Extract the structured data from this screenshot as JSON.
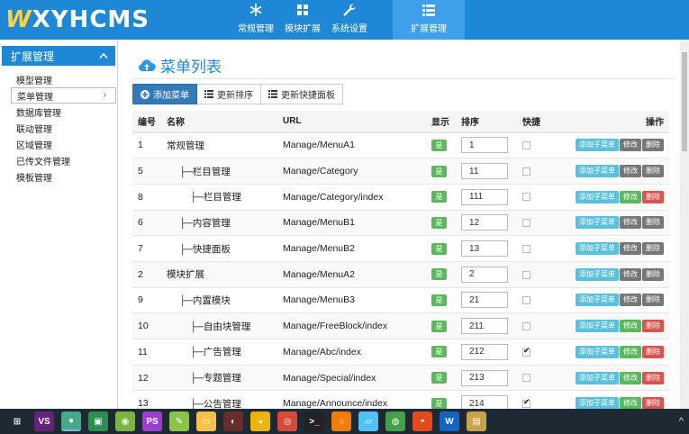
{
  "logo": {
    "mark": "W",
    "text": "XYHCMS"
  },
  "nav": [
    {
      "label": "常规管理",
      "icon": "snowflake-icon"
    },
    {
      "label": "模块扩展",
      "icon": "grid-icon"
    },
    {
      "label": "系统设置",
      "icon": "wrench-icon"
    },
    {
      "label": "扩展管理",
      "icon": "list-icon",
      "active": true
    }
  ],
  "sidebar": {
    "title": "扩展管理",
    "items": [
      {
        "label": "模型管理"
      },
      {
        "label": "菜单管理",
        "active": true,
        "arrow": "›"
      },
      {
        "label": "数据库管理"
      },
      {
        "label": "联动管理"
      },
      {
        "label": "区域管理"
      },
      {
        "label": "已传文件管理"
      },
      {
        "label": "模板管理"
      }
    ]
  },
  "main": {
    "title": "菜单列表",
    "toolbar": {
      "add": "添加菜单",
      "sort": "更新排序",
      "quick": "更新快捷面板"
    },
    "columns": {
      "id": "编号",
      "name": "名称",
      "url": "URL",
      "show": "显示",
      "sort": "排序",
      "quick": "快捷",
      "ops": "操作"
    },
    "show_label": "是",
    "ops": {
      "add": "添加子菜单",
      "edit": "修改",
      "del": "删除"
    },
    "rows": [
      {
        "id": "1",
        "name": "常规管理",
        "url": "Manage/MenuA1",
        "sort": "1",
        "quick": false,
        "deletable": false
      },
      {
        "id": "5",
        "name": "├─栏目管理",
        "url": "Manage/Category",
        "sort": "11",
        "quick": false,
        "deletable": false
      },
      {
        "id": "8",
        "name": "├─栏目管理",
        "url": "Manage/Category/index",
        "sort": "111",
        "quick": false,
        "deletable": true
      },
      {
        "id": "6",
        "name": "├─内容管理",
        "url": "Manage/MenuB1",
        "sort": "12",
        "quick": false,
        "deletable": false
      },
      {
        "id": "7",
        "name": "├─快捷面板",
        "url": "Manage/MenuB2",
        "sort": "13",
        "quick": false,
        "deletable": false
      },
      {
        "id": "2",
        "name": "模块扩展",
        "url": "Manage/MenuA2",
        "sort": "2",
        "quick": false,
        "deletable": false
      },
      {
        "id": "9",
        "name": "├─内置模块",
        "url": "Manage/MenuB3",
        "sort": "21",
        "quick": false,
        "deletable": false
      },
      {
        "id": "10",
        "name": "├─自由块管理",
        "url": "Manage/FreeBlock/index",
        "sort": "211",
        "quick": false,
        "deletable": true
      },
      {
        "id": "11",
        "name": "├─广告管理",
        "url": "Manage/Abc/index",
        "sort": "212",
        "quick": true,
        "deletable": true
      },
      {
        "id": "12",
        "name": "├─专题管理",
        "url": "Manage/Special/index",
        "sort": "213",
        "quick": false,
        "deletable": true
      },
      {
        "id": "13",
        "name": "├─公告管理",
        "url": "Manage/Announce/index",
        "sort": "214",
        "quick": true,
        "deletable": true
      }
    ]
  },
  "taskbar": {
    "apps": [
      {
        "icon": "task-view-icon",
        "color": "#1d2a34",
        "glyph": "⊞"
      },
      {
        "icon": "visual-studio-icon",
        "color": "#68217a",
        "glyph": "VS"
      },
      {
        "icon": "chrome-icon",
        "color": "#4a8",
        "glyph": "●",
        "active": true
      },
      {
        "icon": "app-green-icon",
        "color": "#2d8f4e",
        "glyph": "▣"
      },
      {
        "icon": "android-icon",
        "color": "#7cb342",
        "glyph": "◉"
      },
      {
        "icon": "phpstorm-icon",
        "color": "#9b3fd1",
        "glyph": "PS"
      },
      {
        "icon": "notepad-icon",
        "color": "#8bc34a",
        "glyph": "✎"
      },
      {
        "icon": "folder-icon",
        "color": "#f5c04a",
        "glyph": "▭"
      },
      {
        "icon": "media-icon",
        "color": "#6a2b2b",
        "glyph": "◐"
      },
      {
        "icon": "chat-icon",
        "color": "#f0b400",
        "glyph": "◕"
      },
      {
        "icon": "browser-red-icon",
        "color": "#d84a38",
        "glyph": "◎"
      },
      {
        "icon": "terminal-icon",
        "color": "#222",
        "glyph": ">_"
      },
      {
        "icon": "ring-icon",
        "color": "#f57c00",
        "glyph": "○"
      },
      {
        "icon": "note-icon",
        "color": "#4fc3f7",
        "glyph": "▱"
      },
      {
        "icon": "wechat-icon",
        "color": "#43a047",
        "glyph": "◍"
      },
      {
        "icon": "ball-icon",
        "color": "#e64a19",
        "glyph": "◓"
      },
      {
        "icon": "wps-icon",
        "color": "#1565c0",
        "glyph": "W"
      },
      {
        "icon": "archive-icon",
        "color": "#c9a24a",
        "glyph": "▤"
      }
    ],
    "tray": "^"
  }
}
